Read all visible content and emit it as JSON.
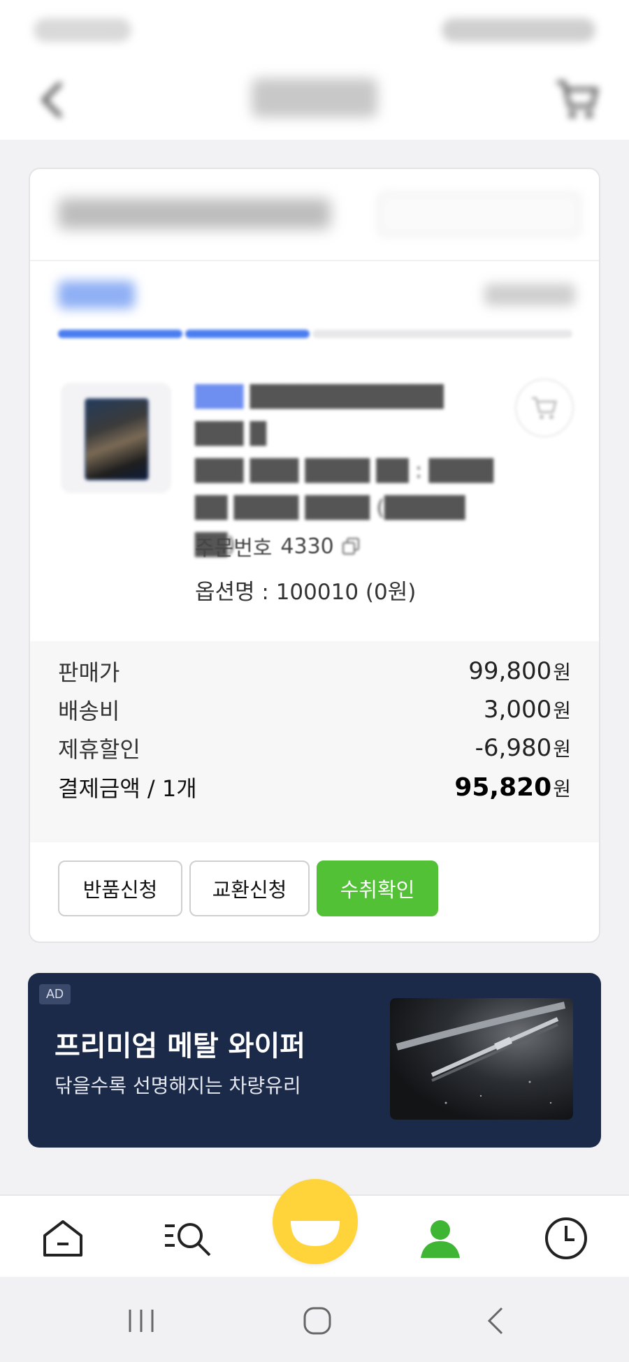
{
  "product": {
    "order_label": "주문번호",
    "order_number": "4330",
    "option": "옵션명 : 100010 (0원)"
  },
  "summary": {
    "price_label": "판매가",
    "price_value": "99,800",
    "shipping_label": "배송비",
    "shipping_value": "3,000",
    "discount_label": "제휴할인",
    "discount_value": "-6,980",
    "total_label": "결제금액 / 1개",
    "total_value": "95,820",
    "currency": "원"
  },
  "actions": {
    "return_label": "반품신청",
    "exchange_label": "교환신청",
    "confirm_label": "수취확인"
  },
  "ad": {
    "badge": "AD",
    "title": "프리미엄 메탈 와이퍼",
    "subtitle": "닦을수록 선명해지는 차량유리"
  },
  "colors": {
    "accent_green": "#52c136",
    "progress_blue": "#4a7df0",
    "ad_navy": "#1c2a4a",
    "center_yellow": "#ffd43a"
  },
  "icons": {
    "nav": [
      "home-icon",
      "search-menu-icon",
      "smile-icon",
      "profile-icon",
      "clock-icon"
    ],
    "system": [
      "recent-apps-icon",
      "home-circle-icon",
      "back-chevron-icon"
    ]
  }
}
